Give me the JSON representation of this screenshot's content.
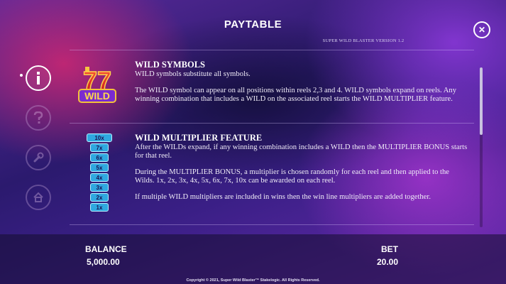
{
  "header": {
    "title": "PAYTABLE",
    "version": "SUPER WILD BLASTER VERSION 1.2"
  },
  "side_nav": {
    "items": [
      {
        "name": "info",
        "icon": "info-icon",
        "active": true
      },
      {
        "name": "help",
        "icon": "question-icon",
        "active": false
      },
      {
        "name": "settings",
        "icon": "wrench-icon",
        "active": false
      },
      {
        "name": "home",
        "icon": "home-icon",
        "active": false
      }
    ]
  },
  "sections": {
    "wild": {
      "logo_text": "WILD",
      "logo_number": "77",
      "title": "WILD SYMBOLS",
      "paragraphs": [
        "WILD symbols substitute all symbols.",
        "The WILD symbol can appear on all positions within reels 2,3 and 4. WILD symbols expand on reels. Any winning combination that includes a WILD on the associated reel starts the WILD MULTIPLIER feature."
      ]
    },
    "multiplier": {
      "title": "WILD MULTIPLIER FEATURE",
      "multipliers": [
        "10x",
        "7x",
        "6x",
        "5x",
        "4x",
        "3x",
        "2x",
        "1x"
      ],
      "paragraphs": [
        "After the WILDs expand, if any winning combination includes a WILD then the MULTIPLIER BONUS starts for that reel.",
        "During the MULTIPLIER BONUS, a multiplier is chosen randomly for each reel and then applied to the Wilds. 1x, 2x, 3x, 4x, 5x, 6x, 7x, 10x can be awarded on each reel.",
        "If multiple WILD multipliers are included in wins then the win line multipliers are added together."
      ]
    }
  },
  "footer": {
    "balance_label": "BALANCE",
    "balance_value": "5,000.00",
    "bet_label": "BET",
    "bet_value": "20.00",
    "copyright": "Copyright © 2021, Super Wild Blaster™ Stakelogic. All Rights Reserved."
  },
  "colors": {
    "accent": "#ffffff",
    "multiplier_fill": "#2fa8e0",
    "wild_red": "#e8322a",
    "wild_purple": "#7a2bd0"
  }
}
